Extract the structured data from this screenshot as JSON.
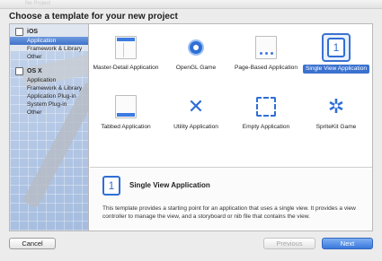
{
  "window": {
    "title_ghost": "Ne Project",
    "heading": "Choose a template for your new project"
  },
  "sidebar": {
    "groups": [
      {
        "label": "iOS",
        "icon": "iphone-icon",
        "items": [
          "Application",
          "Framework & Library",
          "Other"
        ],
        "selected": 0
      },
      {
        "label": "OS X",
        "icon": "mac-icon",
        "items": [
          "Application",
          "Framework & Library",
          "Application Plug-in",
          "System Plug-in",
          "Other"
        ]
      }
    ]
  },
  "templates": [
    {
      "label": "Master-Detail Application",
      "icon": "master-detail-icon"
    },
    {
      "label": "OpenGL Game",
      "icon": "opengl-icon"
    },
    {
      "label": "Page-Based Application",
      "icon": "page-based-icon"
    },
    {
      "label": "Single View Application",
      "icon": "single-view-icon",
      "glyph": "1",
      "selected": true
    },
    {
      "label": "Tabbed Application",
      "icon": "tabbed-icon"
    },
    {
      "label": "Utility Application",
      "icon": "wrench-icon"
    },
    {
      "label": "Empty Application",
      "icon": "empty-icon"
    },
    {
      "label": "SpriteKit Game",
      "icon": "spritekit-icon"
    }
  ],
  "description": {
    "glyph": "1",
    "title": "Single View Application",
    "text": "This template provides a starting point for an application that uses a single view. It provides a view controller to manage the view, and a storyboard or nib file that contains the view."
  },
  "buttons": {
    "cancel": "Cancel",
    "previous": "Previous",
    "next": "Next"
  },
  "colors": {
    "accent": "#3b72d0",
    "selection_bg": "#3f72c9"
  }
}
